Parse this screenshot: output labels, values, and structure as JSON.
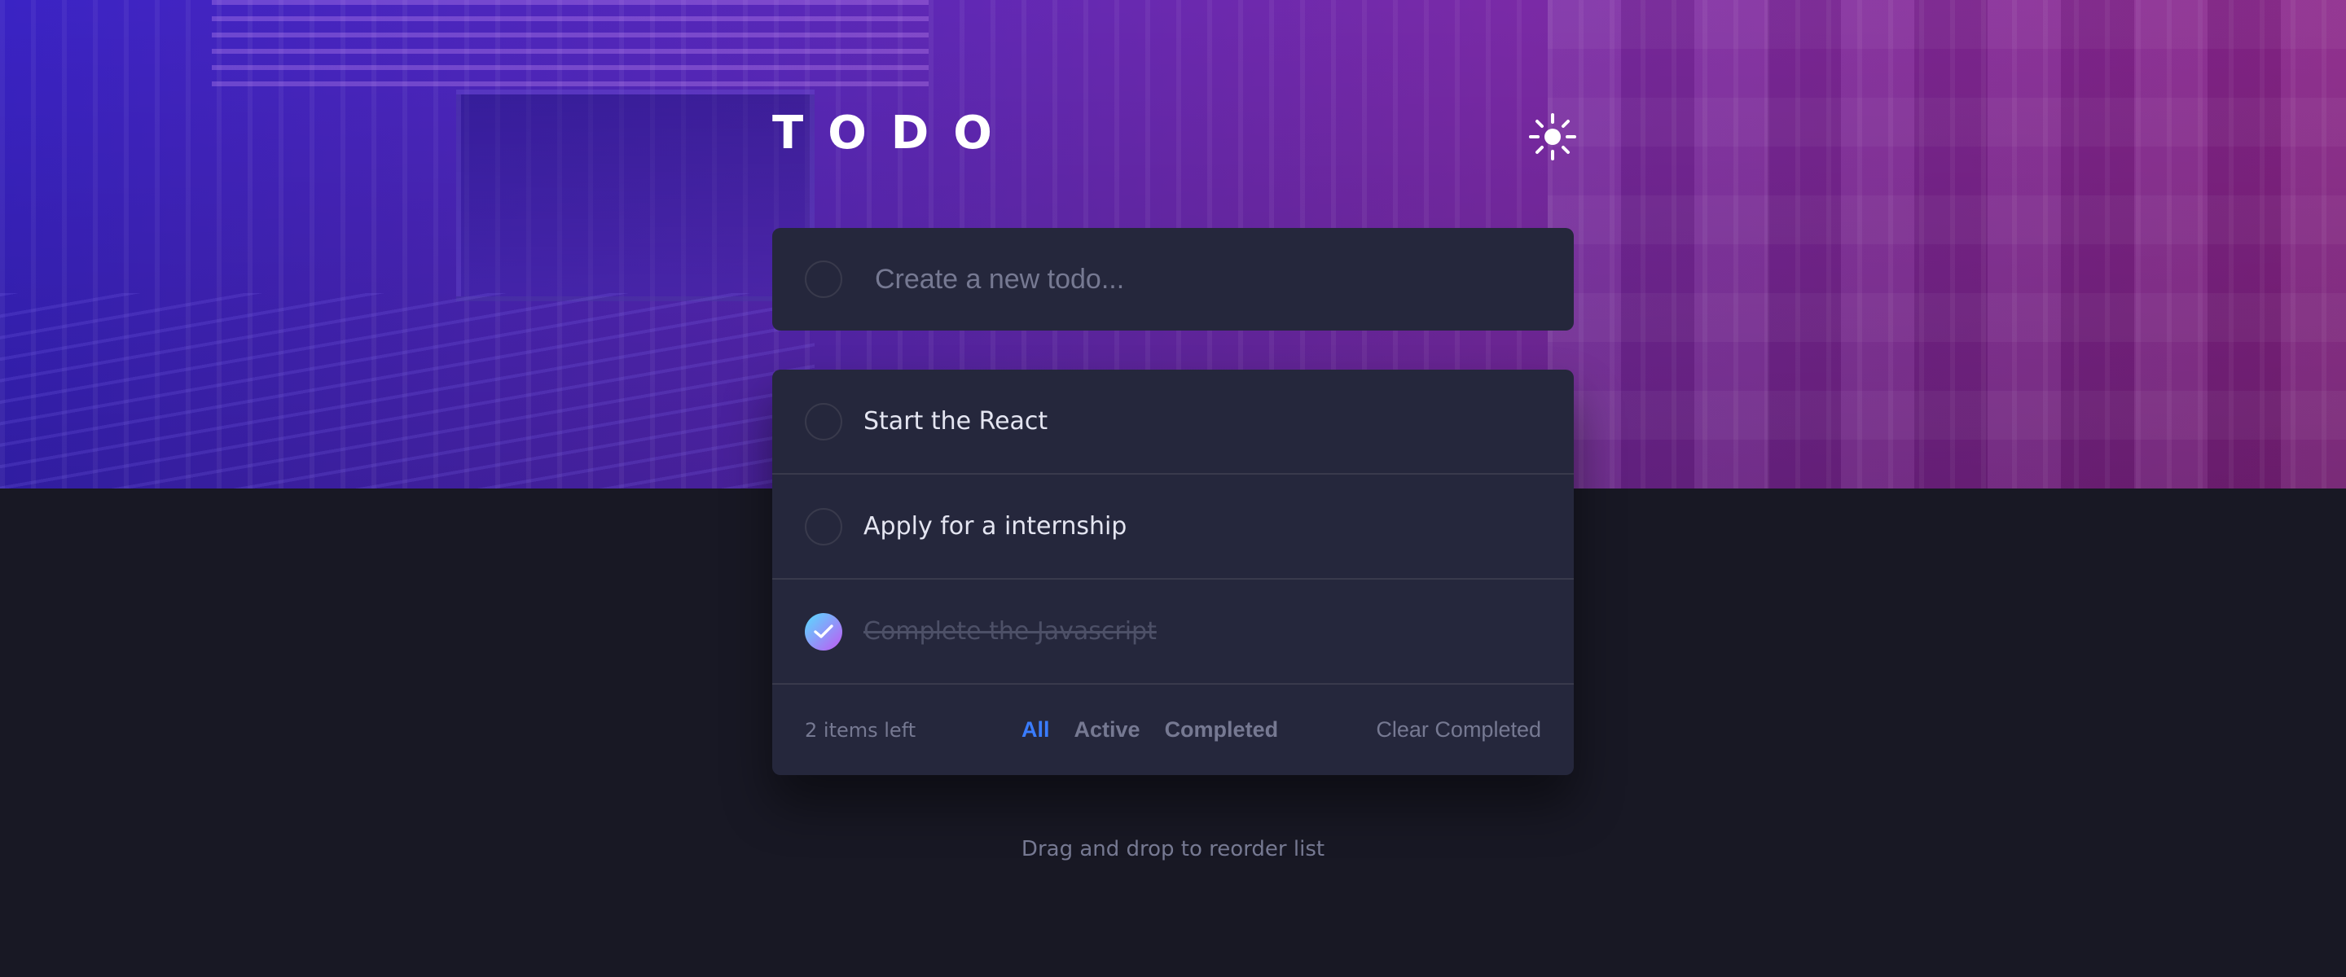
{
  "app": {
    "title": "TODO"
  },
  "new_todo": {
    "placeholder": "Create a new todo...",
    "value": ""
  },
  "todos": [
    {
      "text": "Start the React",
      "completed": false
    },
    {
      "text": "Apply for a internship",
      "completed": false
    },
    {
      "text": "Complete the Javascript",
      "completed": true
    }
  ],
  "footer": {
    "items_left": "2 items left",
    "filters": [
      "All",
      "Active",
      "Completed"
    ],
    "active_filter": "All",
    "clear_label": "Clear Completed"
  },
  "hint": "Drag and drop to reorder list",
  "icons": {
    "theme_toggle": "sun-icon",
    "check": "check-icon"
  },
  "colors": {
    "accent": "#3a7cfd",
    "check_gradient_start": "#57ddff",
    "check_gradient_end": "#c058f3",
    "card": "#25273c",
    "page": "#181824"
  }
}
